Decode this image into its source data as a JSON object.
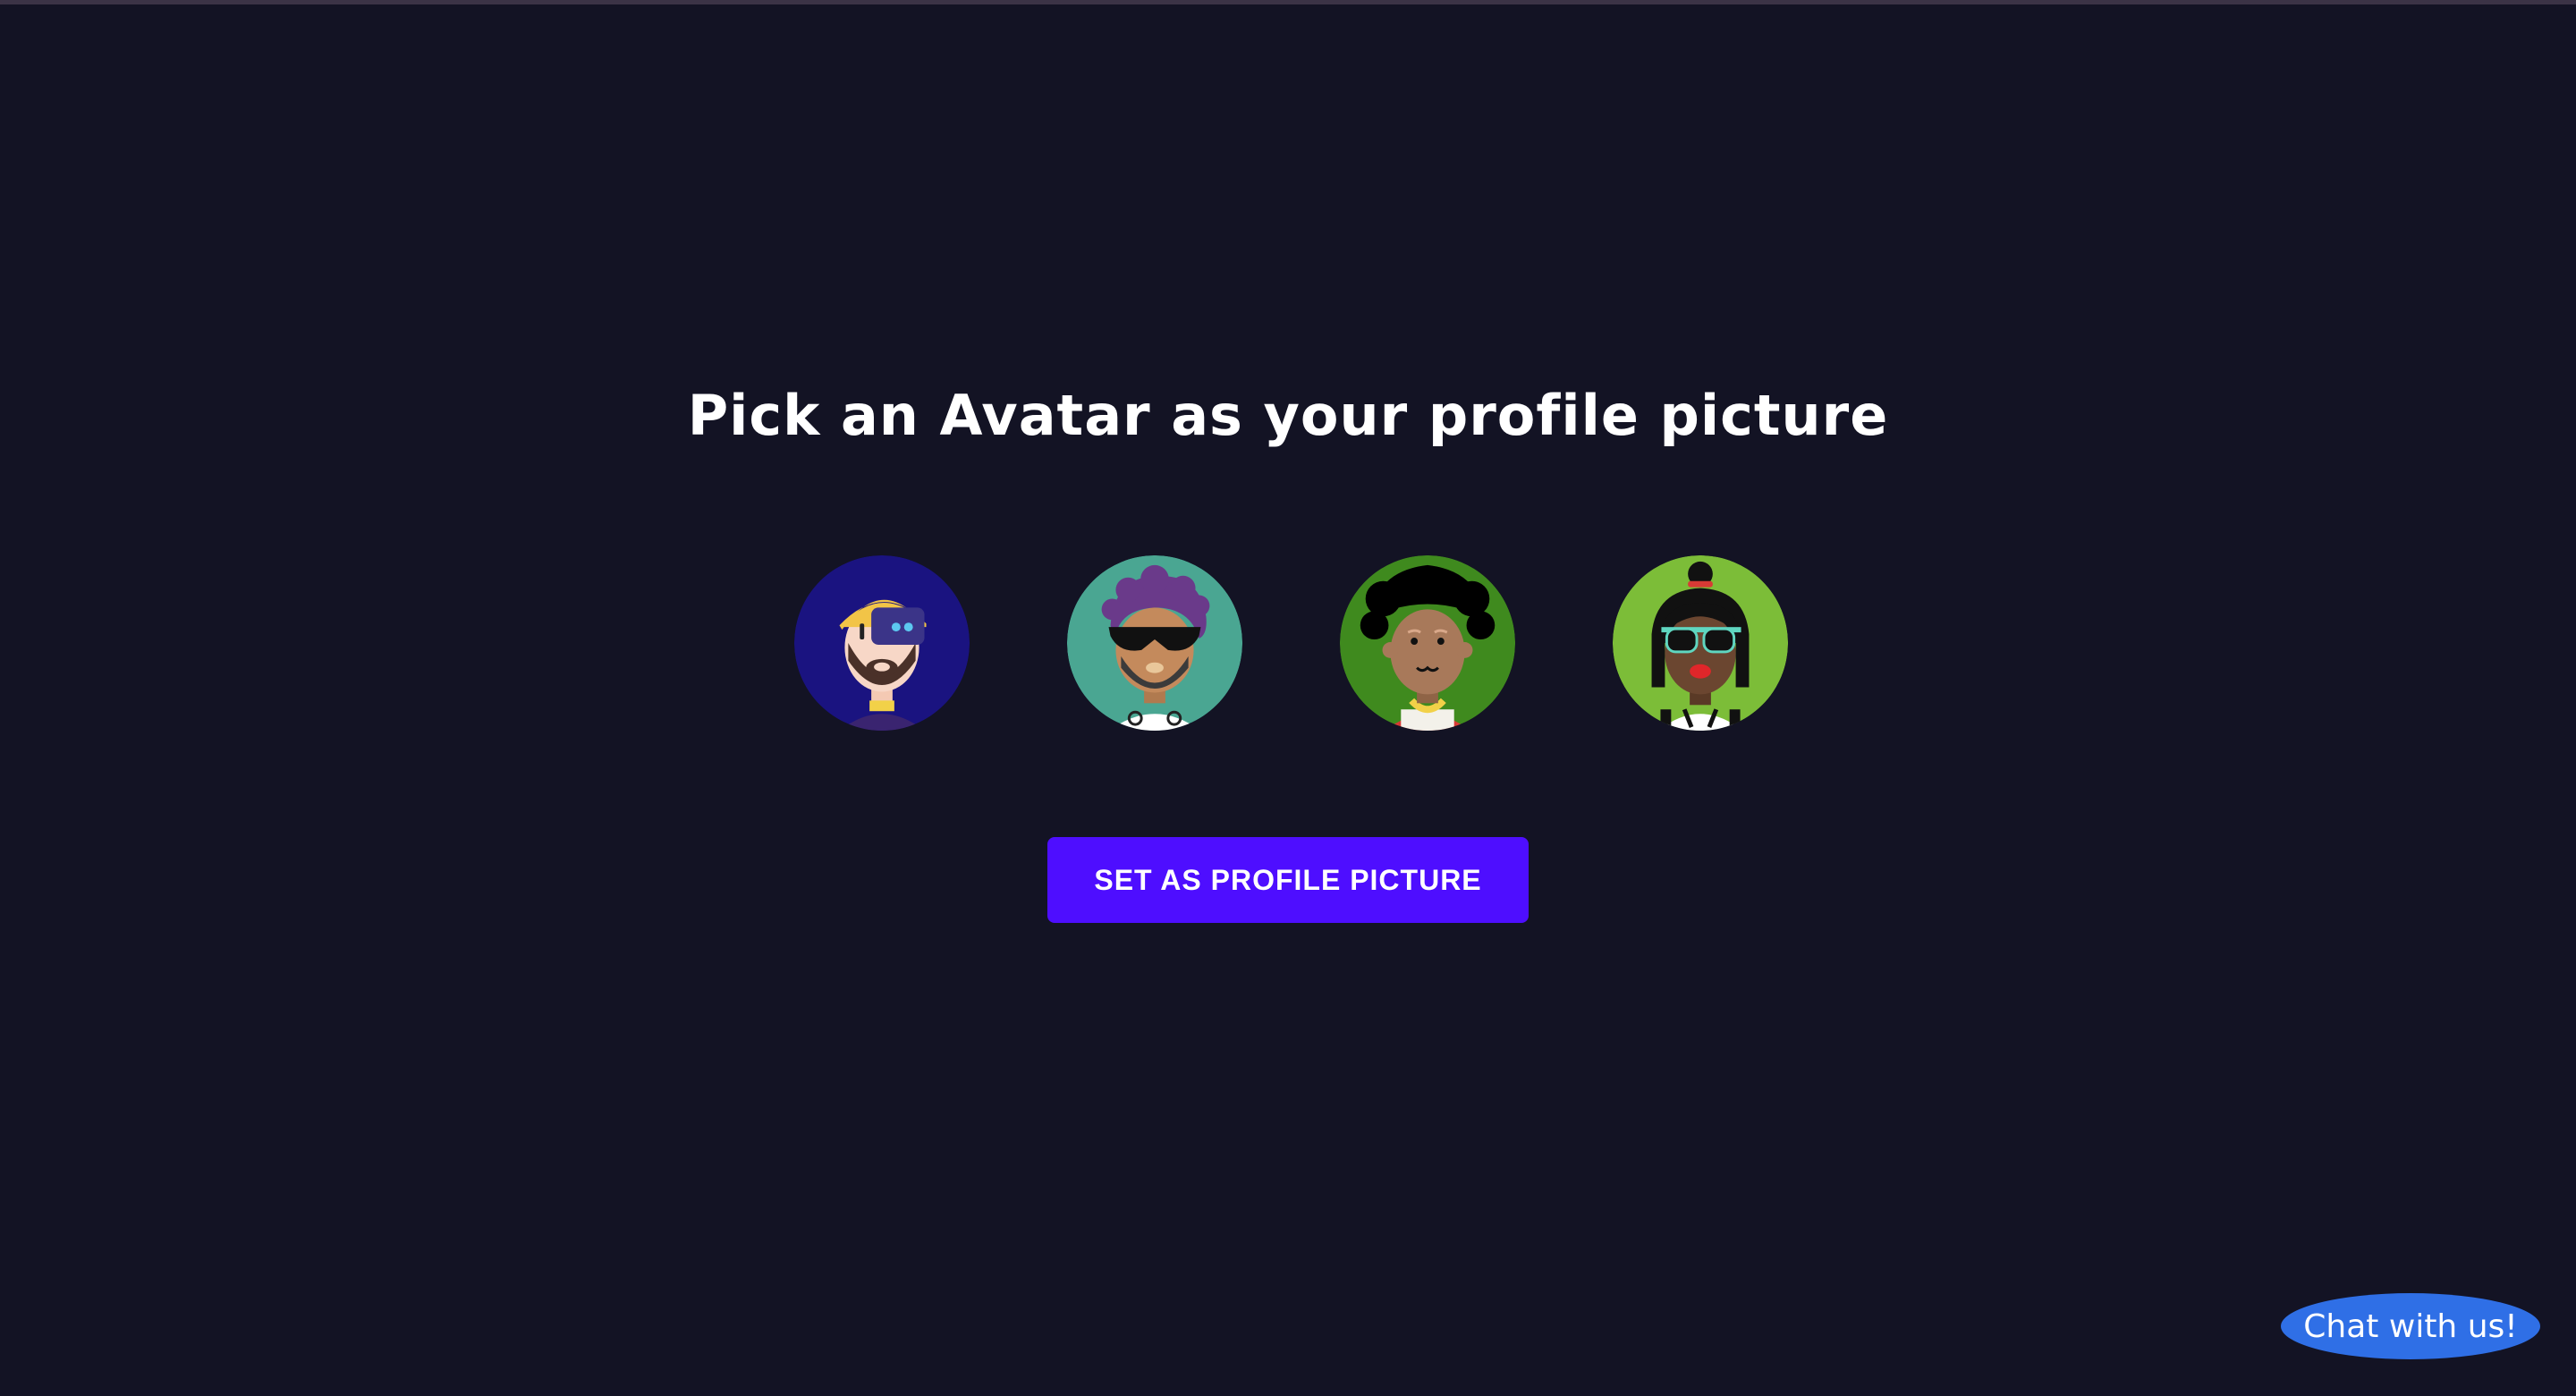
{
  "heading": "Pick an Avatar as your profile picture",
  "avatars": [
    {
      "name": "avatar-1",
      "bg": "#1a1380"
    },
    {
      "name": "avatar-2",
      "bg": "#4aa692"
    },
    {
      "name": "avatar-3",
      "bg": "#3f8a1e"
    },
    {
      "name": "avatar-4",
      "bg": "#7cbd38"
    }
  ],
  "button_label": "SET AS PROFILE PICTURE",
  "chat_label": "Chat with us!",
  "colors": {
    "background": "#131324",
    "accent": "#4e0eff",
    "chat": "#2f6fe6"
  }
}
